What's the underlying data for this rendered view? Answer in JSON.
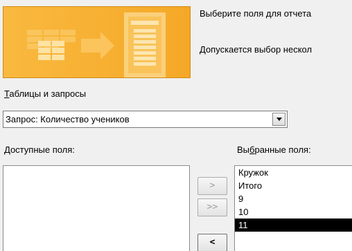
{
  "description": {
    "line1": "Выберите поля для отчета",
    "line2": "Допускается выбор нескол"
  },
  "tables_label": {
    "hotkey": "Т",
    "rest": "аблицы и запросы"
  },
  "query_combo": {
    "value": "Запрос: Количество учеников",
    "arrow_icon": "chevron-down-icon"
  },
  "available_label": {
    "hotkey": "Д",
    "rest": "оступные поля:"
  },
  "selected_label": {
    "before": "Вы",
    "hotkey": "б",
    "rest": "ранные поля:"
  },
  "available_fields": [],
  "selected_fields": [
    {
      "label": "Кружок",
      "selected": false
    },
    {
      "label": "Итого",
      "selected": false
    },
    {
      "label": "9",
      "selected": false
    },
    {
      "label": "10",
      "selected": false
    },
    {
      "label": "11",
      "selected": true
    }
  ],
  "buttons": {
    "add": ">",
    "add_all": ">>",
    "remove": "<"
  },
  "colors": {
    "banner": "#f7b033",
    "selection": "#000000"
  }
}
